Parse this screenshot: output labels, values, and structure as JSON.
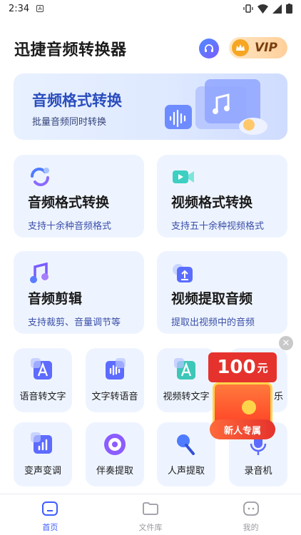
{
  "status_bar": {
    "time": "2:34",
    "notif_glyph": "A"
  },
  "header": {
    "title": "迅捷音频转换器",
    "vip_label": "VIP"
  },
  "banner": {
    "title": "音频格式转换",
    "subtitle": "批量音频同时转换"
  },
  "feature_cards": [
    {
      "title": "音频格式转换",
      "subtitle": "支持十余种音频格式",
      "icon": "audio-convert-icon"
    },
    {
      "title": "视频格式转换",
      "subtitle": "支持五十余种视频格式",
      "icon": "video-convert-icon"
    },
    {
      "title": "音频剪辑",
      "subtitle": "支持裁剪、音量调节等",
      "icon": "music-note-icon"
    },
    {
      "title": "视频提取音频",
      "subtitle": "提取出视频中的音频",
      "icon": "upload-icon"
    }
  ],
  "tools": [
    {
      "label": "语音转文字",
      "icon": "text-a-icon"
    },
    {
      "label": "文字转语音",
      "icon": "voice-wave-icon"
    },
    {
      "label": "视频转文字",
      "icon": "text-a-icon"
    },
    {
      "label": "乐",
      "icon": "music-icon"
    },
    {
      "label": "变声变调",
      "icon": "bars-icon"
    },
    {
      "label": "伴奏提取",
      "icon": "disc-icon"
    },
    {
      "label": "人声提取",
      "icon": "microphone-icon"
    },
    {
      "label": "录音机",
      "icon": "recorder-icon"
    }
  ],
  "promo": {
    "amount": "100",
    "unit": "元",
    "ribbon": "新人专属",
    "close": "✕"
  },
  "nav": [
    {
      "label": "首页",
      "icon": "home-icon"
    },
    {
      "label": "文件库",
      "icon": "folder-icon"
    },
    {
      "label": "我的",
      "icon": "profile-icon"
    }
  ],
  "colors": {
    "accent": "#3d5cff",
    "card_bg": "#eef4ff",
    "promo_red": "#e5322d"
  }
}
